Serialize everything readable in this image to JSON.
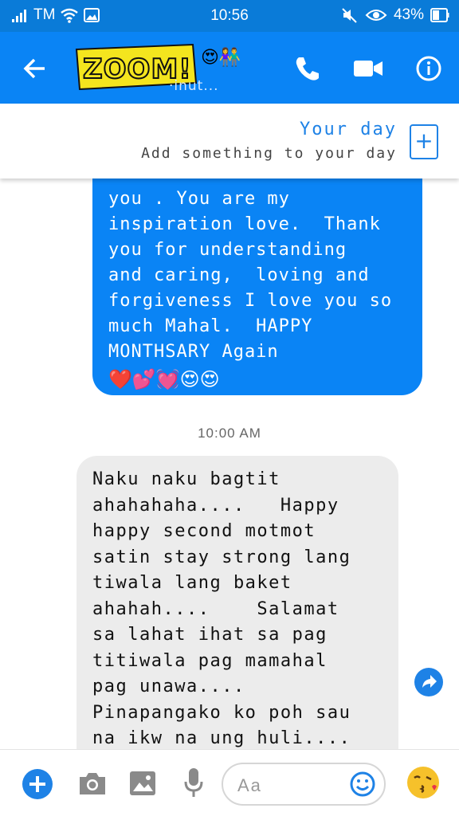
{
  "status_bar": {
    "carrier": "TM",
    "time": "10:56",
    "battery": "43%"
  },
  "header": {
    "sticker_text": "ZOOM!",
    "contact_emoji": "😍👫",
    "contact_status": "·inut...",
    "icons": [
      "back-arrow-icon",
      "phone-icon",
      "video-camera-icon",
      "info-icon"
    ]
  },
  "your_day": {
    "title": "Your day",
    "subtitle": "Add something to your day",
    "add_symbol": "+"
  },
  "messages": {
    "outgoing_text": "you . You are my\ninspiration love.  Thank\nyou for understanding\nand caring,  loving and\nforgiveness I love you so\nmuch Mahal.  HAPPY\nMONTHSARY Again",
    "outgoing_emoji": "❤️💕💓😍😍",
    "timestamp": "10:00 AM",
    "incoming_text": "Naku naku bagtit\nahahahaha....   Happy\nhappy second motmot\nsatin stay strong lang\ntiwala lang baket\nahahah....    Salamat\nsa lahat ihat sa pag\ntitiwala pag mamahal\npag unawa....\nPinapangako ko poh sau\nna ikw na ung huli....\nMahal na mahal kita..."
  },
  "composer": {
    "placeholder": "Aa",
    "quick_emoji": "😘",
    "accent_color": "#1e82e6"
  },
  "colors": {
    "header_blue": "#0a84f5",
    "status_blue": "#0a7bd8",
    "incoming_bubble": "#ececec"
  }
}
